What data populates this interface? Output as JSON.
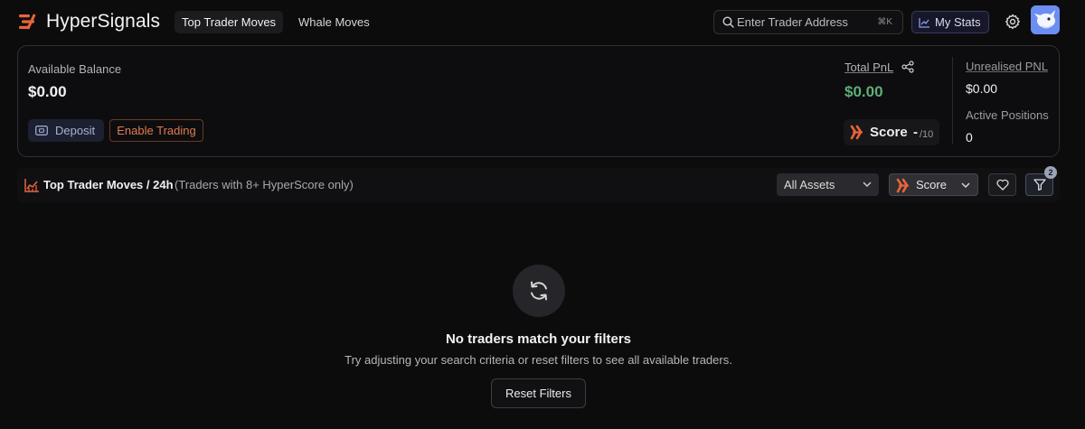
{
  "header": {
    "brand": "HyperSignals",
    "tabs": [
      {
        "label": "Top Trader Moves",
        "active": true
      },
      {
        "label": "Whale Moves",
        "active": false
      }
    ],
    "search": {
      "placeholder": "Enter Trader Address",
      "shortcut": "⌘K",
      "icon": "search-icon"
    },
    "my_stats_label": "My Stats",
    "settings_icon": "gear-icon"
  },
  "account": {
    "available_balance_label": "Available Balance",
    "available_balance": "$0.00",
    "deposit_label": "Deposit",
    "enable_trading_label": "Enable Trading",
    "total_pnl_label": "Total PnL",
    "total_pnl": "$0.00",
    "score_label": "Score",
    "score_value": "-",
    "score_max": "/10",
    "unrealised_pnl_label": "Unrealised PNL",
    "unrealised_pnl": "$0.00",
    "active_positions_label": "Active Positions",
    "active_positions": "0"
  },
  "section": {
    "title": "Top Trader Moves / 24h",
    "subtitle": "(Traders with 8+ HyperScore only)",
    "assets_filter": "All Assets",
    "sort_filter": "Score",
    "filter_count": "2"
  },
  "empty_state": {
    "title": "No traders match your filters",
    "description": "Try adjusting your search criteria or reset filters to see all available traders.",
    "reset_label": "Reset Filters"
  },
  "colors": {
    "background": "#0c0c0d",
    "brand_orange": "#e8643a",
    "pnl_green": "#5fae78",
    "enable_trading_orange": "#e07b4f",
    "stats_accent": "#3a3a62"
  }
}
